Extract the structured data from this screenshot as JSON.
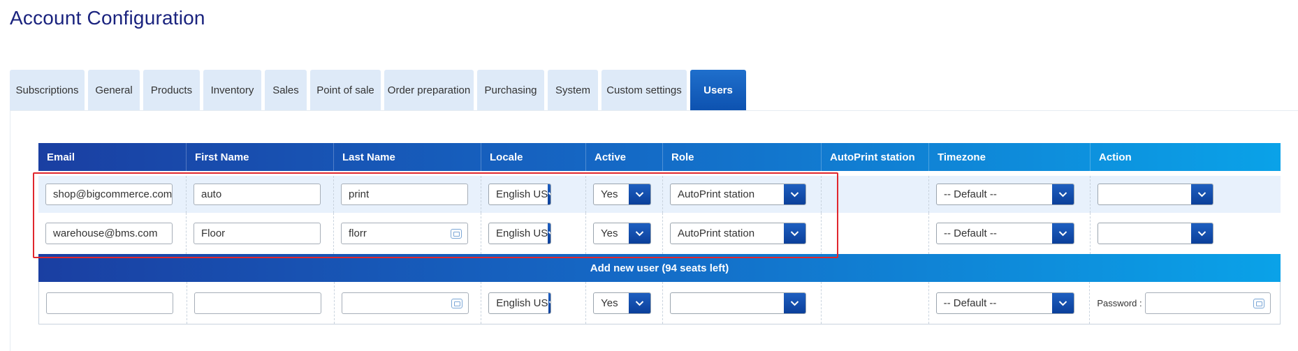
{
  "page": {
    "title": "Account Configuration"
  },
  "tabs": [
    {
      "label": "Subscriptions",
      "active": false
    },
    {
      "label": "General",
      "active": false
    },
    {
      "label": "Products",
      "active": false
    },
    {
      "label": "Inventory",
      "active": false
    },
    {
      "label": "Sales",
      "active": false
    },
    {
      "label": "Point of sale",
      "active": false
    },
    {
      "label": "Order preparation",
      "active": false
    },
    {
      "label": "Purchasing",
      "active": false
    },
    {
      "label": "System",
      "active": false
    },
    {
      "label": "Custom settings",
      "active": false
    },
    {
      "label": "Users",
      "active": true
    }
  ],
  "users_table": {
    "headers": [
      "Email",
      "First Name",
      "Last Name",
      "Locale",
      "Active",
      "Role",
      "AutoPrint station",
      "Timezone",
      "Action"
    ],
    "rows": [
      {
        "email": "shop@bigcommerce.com",
        "first_name": "auto",
        "last_name": "print",
        "locale": "English US",
        "active": "Yes",
        "role": "AutoPrint station",
        "autoprint_station": "",
        "timezone": "-- Default --",
        "action": ""
      },
      {
        "email": "warehouse@bms.com",
        "first_name": "Floor",
        "last_name": "florr",
        "locale": "English US",
        "active": "Yes",
        "role": "AutoPrint station",
        "autoprint_station": "",
        "timezone": "-- Default --",
        "action": ""
      }
    ],
    "add_new_label": "Add new user (94 seats left)",
    "new_user": {
      "email": "",
      "first_name": "",
      "last_name": "",
      "locale": "English US",
      "active": "Yes",
      "role": "",
      "timezone": "-- Default --",
      "password_label": "Password :",
      "password": ""
    }
  },
  "colors": {
    "title": "#1a237e",
    "tab_bg": "#deeaf8",
    "tab_active": "#0d52b0",
    "highlight_border": "#e0262d",
    "header_start": "#1a3fa2",
    "header_end": "#0aa2e8"
  },
  "icons": {
    "select_arrow": "chevron-down-icon",
    "autofill": "contact-card-icon"
  }
}
